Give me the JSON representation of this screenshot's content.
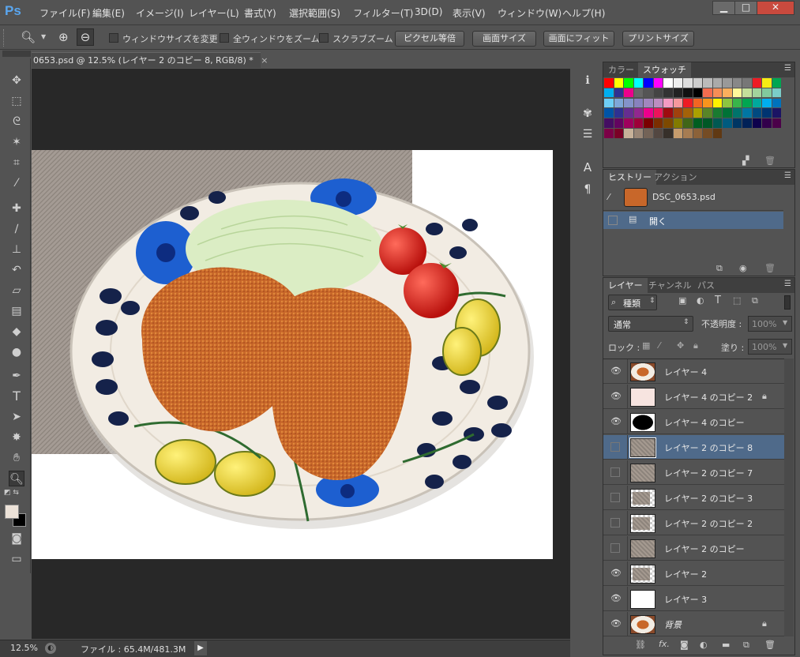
{
  "app": {
    "logo": "Ps"
  },
  "menu": [
    "ファイル(F)",
    "編集(E)",
    "イメージ(I)",
    "レイヤー(L)",
    "書式(Y)",
    "選択範囲(S)",
    "フィルター(T)",
    "3D(D)",
    "表示(V)",
    "ウィンドウ(W)",
    "ヘルプ(H)"
  ],
  "window_buttons": [
    "▁",
    "□",
    "✕"
  ],
  "options": {
    "resize_windows": "ウィンドウサイズを変更",
    "zoom_all": "全ウィンドウをズーム",
    "scrubby": "スクラブズーム",
    "btn_pixels": "ピクセル等倍",
    "btn_canvas": "画面サイズ",
    "btn_fit": "画面にフィット",
    "btn_print": "プリントサイズ"
  },
  "document": {
    "tab_title": "0653.psd @ 12.5% (レイヤー 2 のコピー 8, RGB/8) *",
    "close": "×"
  },
  "status": {
    "zoom": "12.5%",
    "file_info": "ファイル : 65.4M/481.3M"
  },
  "tools": [
    "move-icon",
    "marquee-icon",
    "lasso-icon",
    "magic-wand-icon",
    "crop-icon",
    "eyedropper-icon",
    "healing-icon",
    "brush-icon",
    "stamp-icon",
    "history-brush-icon",
    "eraser-icon",
    "gradient-icon",
    "blur-icon",
    "dodge-icon",
    "pen-icon",
    "type-icon",
    "path-select-icon",
    "shape-icon",
    "hand-icon",
    "zoom-icon"
  ],
  "panels": {
    "color_tabs": [
      "カラー",
      "スウォッチ"
    ],
    "history_tabs": [
      "ヒストリー",
      "アクション"
    ],
    "history_snapshot": "DSC_0653.psd",
    "history_step": "開く",
    "layers_tabs": [
      "レイヤー",
      "チャンネル",
      "パス"
    ],
    "filter_kind": "種類",
    "blend_mode": "通常",
    "opacity_label": "不透明度 :",
    "opacity_value": "100%",
    "lock_label": "ロック :",
    "fill_label": "塗り :",
    "fill_value": "100%"
  },
  "layers": [
    {
      "name": "レイヤー 4",
      "visible": true,
      "thumb": "plate",
      "locked": false,
      "selected": false
    },
    {
      "name": "レイヤー 4 のコピー 2",
      "visible": true,
      "thumb": "pink",
      "locked": true,
      "selected": false
    },
    {
      "name": "レイヤー 4 のコピー",
      "visible": true,
      "thumb": "black-oval",
      "locked": false,
      "selected": false
    },
    {
      "name": "レイヤー 2 のコピー 8",
      "visible": false,
      "thumb": "cloth",
      "locked": false,
      "selected": true
    },
    {
      "name": "レイヤー 2 のコピー 7",
      "visible": false,
      "thumb": "cloth",
      "locked": false,
      "selected": false
    },
    {
      "name": "レイヤー 2 のコピー 3",
      "visible": false,
      "thumb": "cloth-checker",
      "locked": false,
      "selected": false
    },
    {
      "name": "レイヤー 2 のコピー 2",
      "visible": false,
      "thumb": "cloth-checker",
      "locked": false,
      "selected": false
    },
    {
      "name": "レイヤー 2 のコピー",
      "visible": false,
      "thumb": "cloth",
      "locked": false,
      "selected": false
    },
    {
      "name": "レイヤー 2",
      "visible": true,
      "thumb": "cloth-checker",
      "locked": false,
      "selected": false
    },
    {
      "name": "レイヤー 3",
      "visible": true,
      "thumb": "white",
      "locked": false,
      "selected": false
    },
    {
      "name": "背景",
      "visible": true,
      "thumb": "plate",
      "locked": true,
      "selected": false
    }
  ],
  "colors": {
    "accent": "#5aa6ef",
    "selected_row": "#4f6a8a",
    "panel_bg": "#535353"
  }
}
